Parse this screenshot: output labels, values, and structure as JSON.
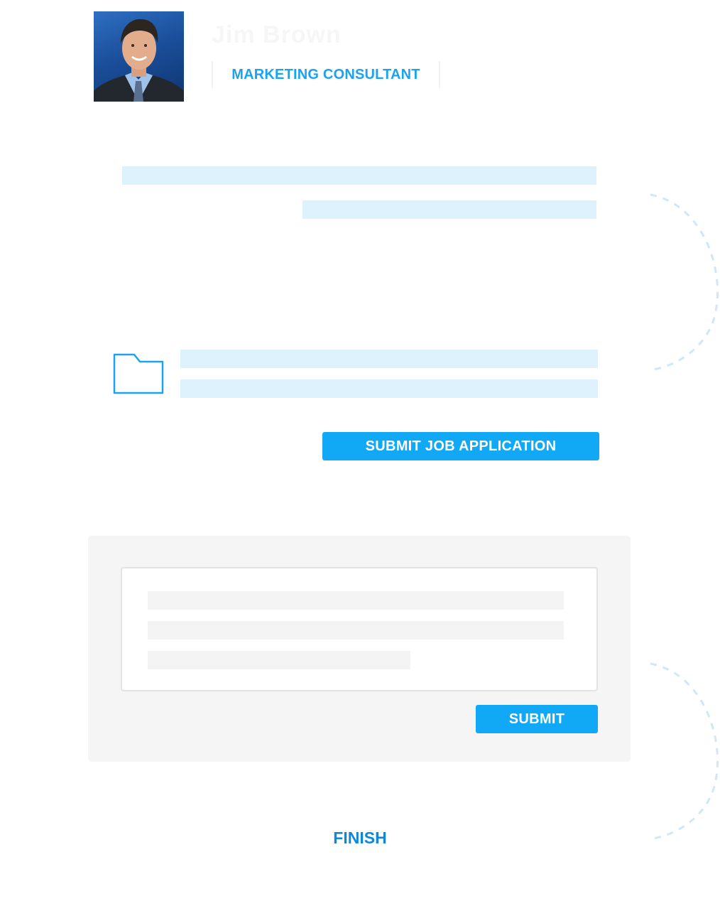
{
  "profile": {
    "name": "Jim Brown",
    "title": "MARKETING CONSULTANT",
    "avatar_icon": "person-photo"
  },
  "application": {
    "submit_label": "SUBMIT JOB APPLICATION",
    "attachment_icon": "folder-icon"
  },
  "message_panel": {
    "submit_label": "SUBMIT"
  },
  "footer": {
    "finish_label": "FINISH"
  },
  "colors": {
    "accent": "#11a9f6",
    "title": "#1aa3ee",
    "finish": "#0f86d8",
    "skeleton_blue": "#ddf2fd",
    "skeleton_grey": "#f4f4f4",
    "panel_bg": "#f5f5f5"
  }
}
